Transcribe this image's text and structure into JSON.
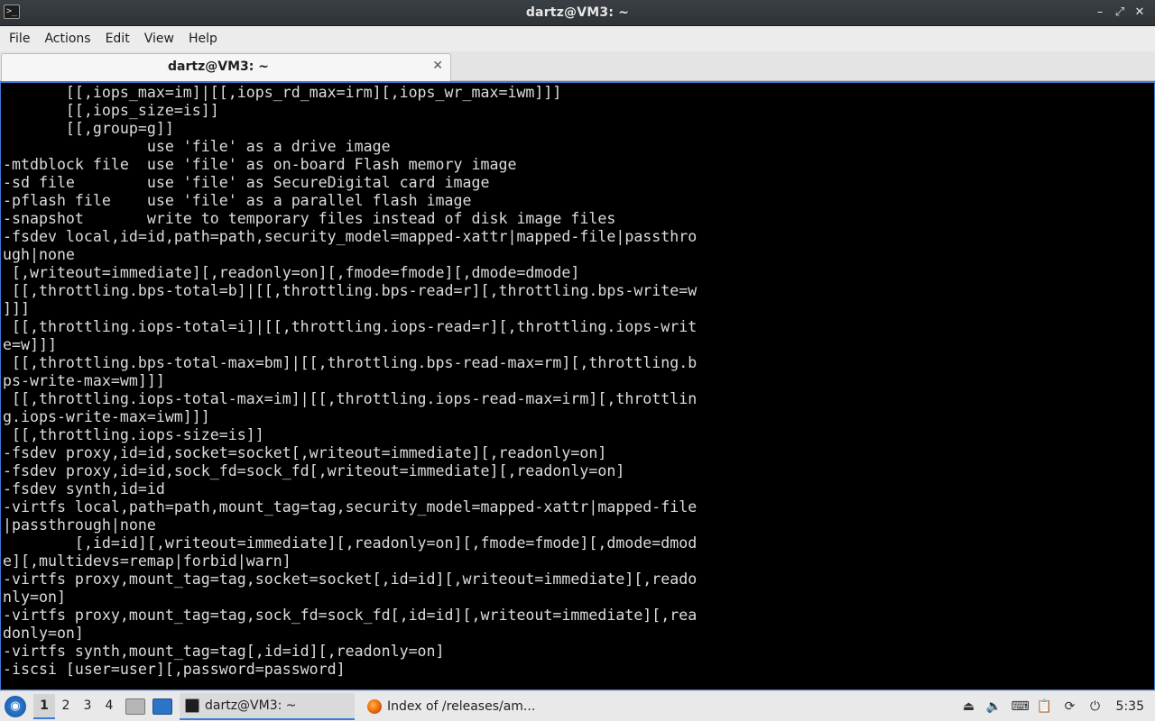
{
  "window": {
    "title": "dartz@VM3: ~",
    "controls": {
      "minimize": "–",
      "maximize": "⤢",
      "close": "✕"
    }
  },
  "menubar": {
    "items": [
      {
        "label": "File"
      },
      {
        "label": "Actions"
      },
      {
        "label": "Edit"
      },
      {
        "label": "View"
      },
      {
        "label": "Help"
      }
    ]
  },
  "tabs": [
    {
      "label": "dartz@VM3: ~",
      "close": "✕"
    }
  ],
  "terminal": {
    "lines": [
      "       [[,iops_max=im]|[[,iops_rd_max=irm][,iops_wr_max=iwm]]]",
      "       [[,iops_size=is]]",
      "       [[,group=g]]",
      "                use 'file' as a drive image",
      "-mtdblock file  use 'file' as on-board Flash memory image",
      "-sd file        use 'file' as SecureDigital card image",
      "-pflash file    use 'file' as a parallel flash image",
      "-snapshot       write to temporary files instead of disk image files",
      "-fsdev local,id=id,path=path,security_model=mapped-xattr|mapped-file|passthro",
      "ugh|none",
      " [,writeout=immediate][,readonly=on][,fmode=fmode][,dmode=dmode]",
      " [[,throttling.bps-total=b]|[[,throttling.bps-read=r][,throttling.bps-write=w",
      "]]]",
      " [[,throttling.iops-total=i]|[[,throttling.iops-read=r][,throttling.iops-writ",
      "e=w]]]",
      " [[,throttling.bps-total-max=bm]|[[,throttling.bps-read-max=rm][,throttling.b",
      "ps-write-max=wm]]]",
      " [[,throttling.iops-total-max=im]|[[,throttling.iops-read-max=irm][,throttlin",
      "g.iops-write-max=iwm]]]",
      " [[,throttling.iops-size=is]]",
      "-fsdev proxy,id=id,socket=socket[,writeout=immediate][,readonly=on]",
      "-fsdev proxy,id=id,sock_fd=sock_fd[,writeout=immediate][,readonly=on]",
      "-fsdev synth,id=id",
      "-virtfs local,path=path,mount_tag=tag,security_model=mapped-xattr|mapped-file",
      "|passthrough|none",
      "        [,id=id][,writeout=immediate][,readonly=on][,fmode=fmode][,dmode=dmod",
      "e][,multidevs=remap|forbid|warn]",
      "-virtfs proxy,mount_tag=tag,socket=socket[,id=id][,writeout=immediate][,reado",
      "nly=on]",
      "-virtfs proxy,mount_tag=tag,sock_fd=sock_fd[,id=id][,writeout=immediate][,rea",
      "donly=on]",
      "-virtfs synth,mount_tag=tag[,id=id][,readonly=on]",
      "-iscsi [user=user][,password=password]"
    ]
  },
  "taskbar": {
    "start_icon": "lubuntu-start-icon",
    "workspaces": [
      "1",
      "2",
      "3",
      "4"
    ],
    "active_workspace": "1",
    "tasks": [
      {
        "label": "dartz@VM3: ~",
        "icon": "terminal-icon",
        "active": true
      },
      {
        "label": "Index of /releases/am...",
        "icon": "firefox-icon",
        "active": false
      }
    ],
    "tray_icons": [
      "eject-icon",
      "volume-icon",
      "keyboard-icon",
      "clipboard-icon",
      "update-icon",
      "power-icon"
    ],
    "clock": "5:35"
  }
}
